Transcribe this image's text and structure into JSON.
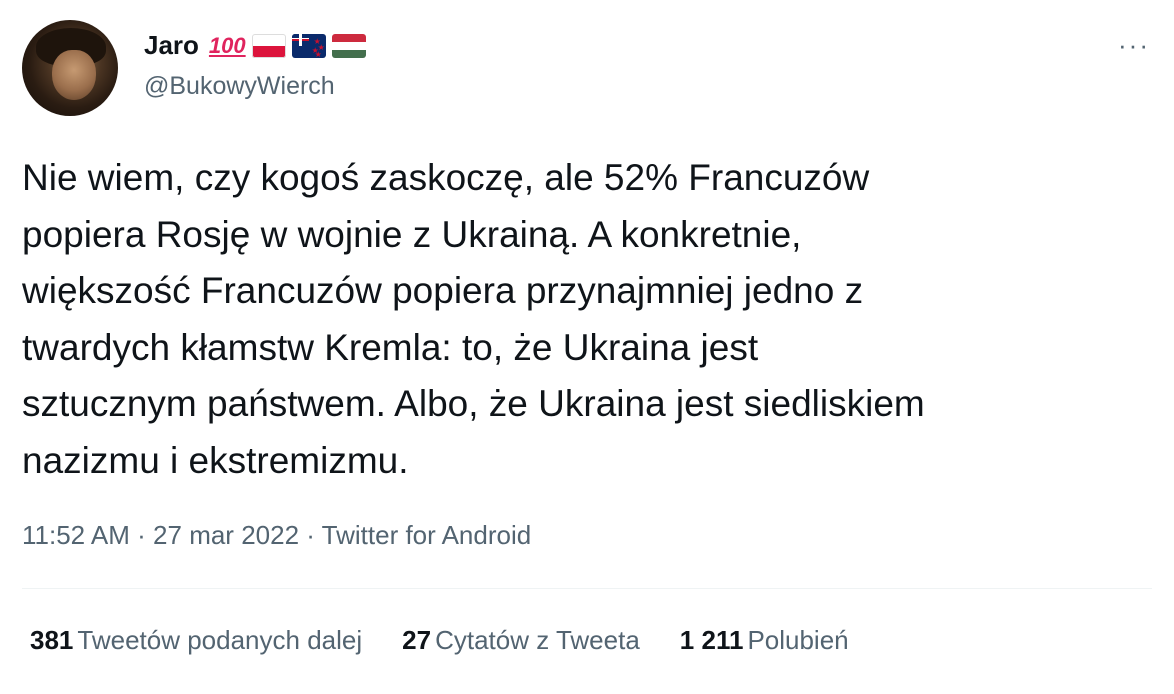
{
  "author": {
    "name": "Jaro",
    "badge_emoji": "100",
    "flags": [
      "flag-poland-icon",
      "flag-new-zealand-icon",
      "flag-hungary-icon"
    ],
    "handle": "@BukowyWierch"
  },
  "menu": {
    "more_label": "···"
  },
  "tweet": {
    "text": "Nie wiem, czy kogoś zaskoczę, ale 52% Francuzów\npopiera Rosję w wojnie z Ukrainą. A konkretnie,\nwiększość Francuzów popiera przynajmniej jedno z\ntwardych kłamstw Kremla: to, że Ukraina jest\nsztucznym państwem. Albo, że Ukraina jest siedliskiem\nnazizmu i ekstremizmu."
  },
  "meta": {
    "time": "11:52 AM",
    "sep1": " · ",
    "date": "27 mar 2022",
    "sep2": " · ",
    "source": "Twitter for Android"
  },
  "stats": {
    "retweets_count": "381",
    "retweets_label": "Tweetów podanych dalej",
    "quotes_count": "27",
    "quotes_label": "Cytatów z Tweeta",
    "likes_count": "1 211",
    "likes_label": "Polubień"
  },
  "colors": {
    "text_primary": "#0f1419",
    "text_secondary": "#536471",
    "divider": "#eff3f4"
  }
}
